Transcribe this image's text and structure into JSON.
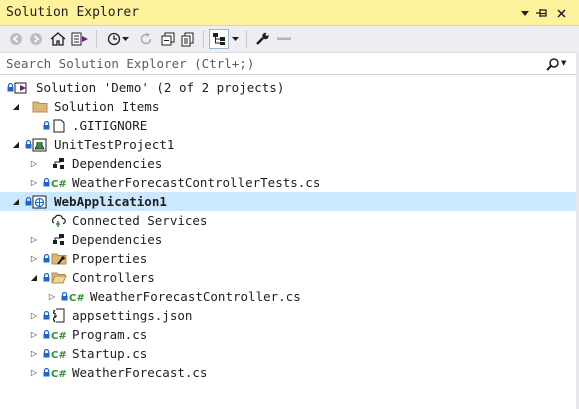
{
  "window": {
    "title": "Solution Explorer",
    "colors": {
      "title_bg": "#fff29d",
      "toolbar_bg": "#eeeef2",
      "selected_bg": "#cce8ff"
    }
  },
  "search": {
    "placeholder": "Search Solution Explorer (Ctrl+;)",
    "value": ""
  },
  "toolbar": {
    "icons": [
      "back-icon",
      "forward-icon",
      "home-icon",
      "switch-views-icon",
      "pending-changes-filter-icon",
      "refresh-icon",
      "collapse-all-icon",
      "show-all-files-icon",
      "sync-active-document-icon",
      "properties-icon",
      "preview-selected-items-icon"
    ]
  },
  "tree": {
    "rows": [
      {
        "label": "Solution 'Demo' (2 of 2 projects)"
      },
      {
        "label": "Solution Items"
      },
      {
        "label": ".GITIGNORE"
      },
      {
        "label": "UnitTestProject1"
      },
      {
        "label": "Dependencies"
      },
      {
        "label": "WeatherForecastControllerTests.cs"
      },
      {
        "label": "WebApplication1"
      },
      {
        "label": "Connected Services"
      },
      {
        "label": "Dependencies"
      },
      {
        "label": "Properties"
      },
      {
        "label": "Controllers"
      },
      {
        "label": "WeatherForecastController.cs"
      },
      {
        "label": "appsettings.json"
      },
      {
        "label": "Program.cs"
      },
      {
        "label": "Startup.cs"
      },
      {
        "label": "WeatherForecast.cs"
      }
    ]
  }
}
